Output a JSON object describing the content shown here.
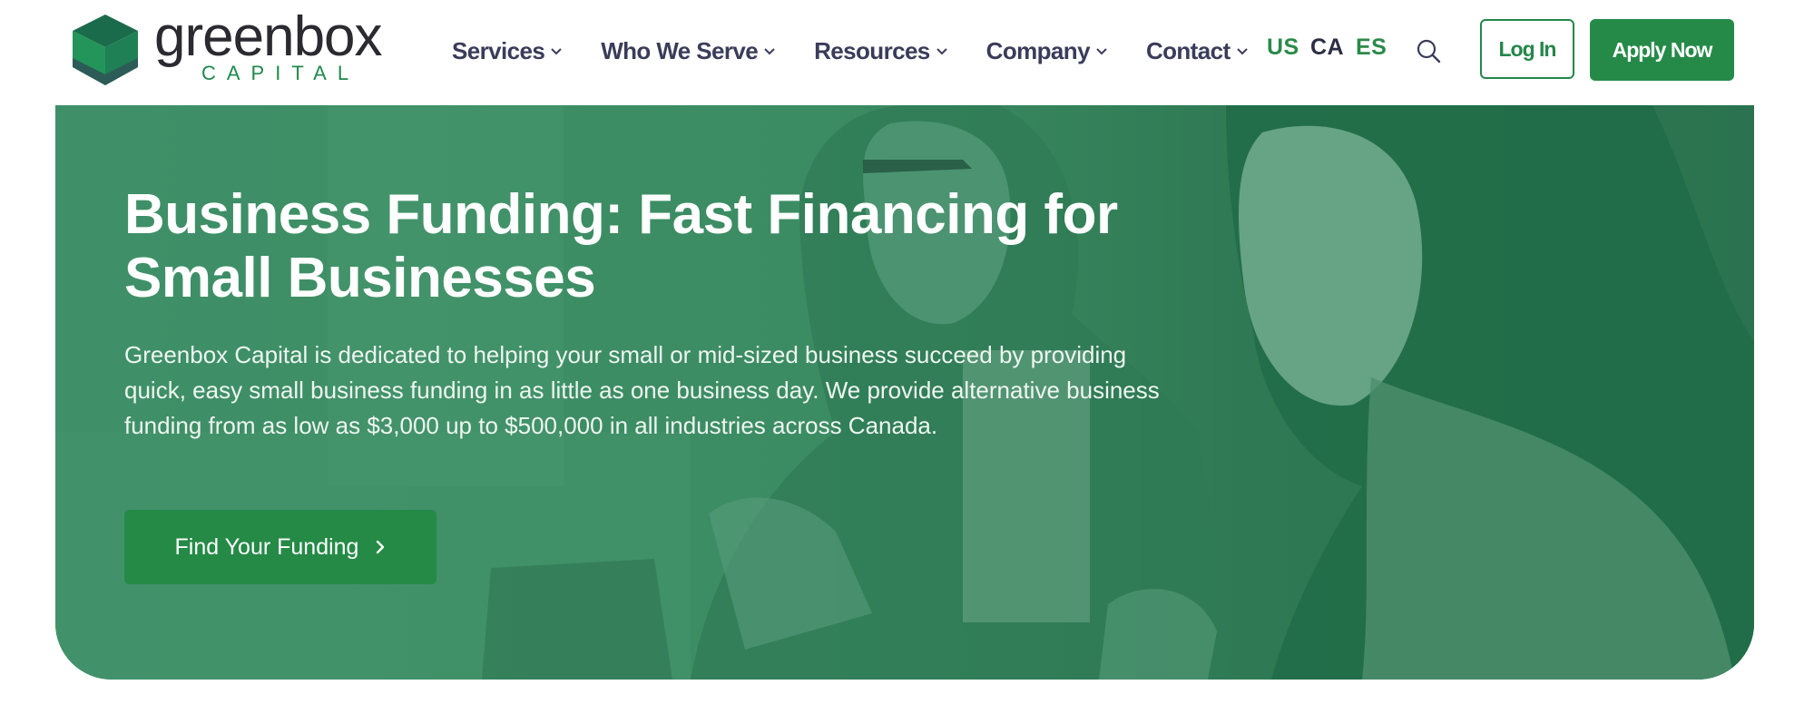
{
  "brand": {
    "name": "greenbox",
    "sub": "CAPITAL"
  },
  "nav": {
    "items": [
      {
        "label": "Services"
      },
      {
        "label": "Who We Serve"
      },
      {
        "label": "Resources"
      },
      {
        "label": "Company"
      },
      {
        "label": "Contact"
      }
    ],
    "languages": [
      {
        "label": "US",
        "color": "#2a8a4a"
      },
      {
        "label": "CA",
        "color": "#2b2d42"
      },
      {
        "label": "ES",
        "color": "#2a8a4a"
      }
    ],
    "search_icon": "search-icon",
    "login_label": "Log In",
    "apply_label": "Apply Now"
  },
  "hero": {
    "title_line1": "Business Funding: Fast Financing for",
    "title_line2": "Small Businesses",
    "description": "Greenbox Capital is dedicated to helping your small or mid-sized business succeed by providing quick, easy small business funding in as little as one business day. We provide alternative business funding from as low as $3,000 up to $500,000 in all industries across Canada.",
    "cta_label": "Find Your Funding",
    "cta_icon": "chevron-right-icon"
  },
  "colors": {
    "brand_green": "#258a48",
    "hero_overlay": "#3d8d64",
    "nav_text": "#3a3c5a"
  }
}
